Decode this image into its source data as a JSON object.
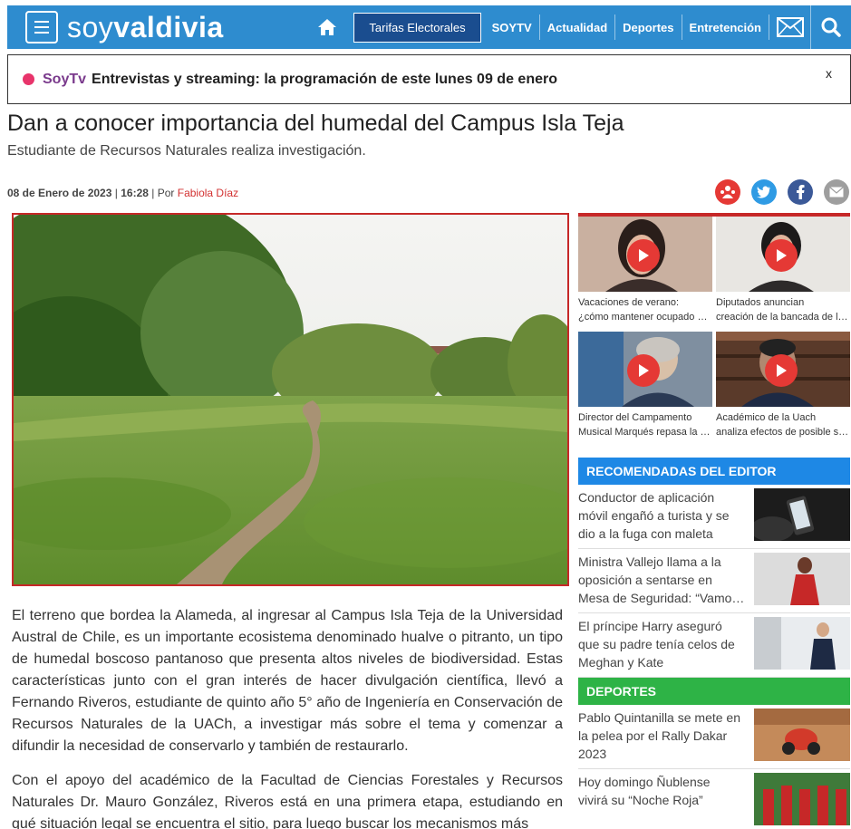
{
  "header": {
    "logo_light": "soy",
    "logo_bold": "valdivia",
    "tarifas": "Tarifas Electorales",
    "nav": [
      "SOYTV",
      "Actualidad",
      "Deportes",
      "Entretención"
    ]
  },
  "ticker": {
    "brand": "SoyTv",
    "text": "Entrevistas y streaming: la programación de este lunes 09 de enero",
    "close": "x"
  },
  "article": {
    "title": "Dan a conocer importancia del humedal del Campus Isla Teja",
    "subtitle": "Estudiante de Recursos Naturales realiza investigación.",
    "date": "08 de Enero de 2023",
    "sep": "|",
    "time": "16:28",
    "por": "| Por",
    "author": "Fabiola Díaz",
    "p1": "El terreno que bordea la Alameda, al ingresar al Campus Isla Teja de la Universidad Austral de Chile, es un importante ecosistema denominado hualve o pitranto, un tipo de humedal boscoso pantanoso que presenta altos niveles de biodiversidad. Estas características junto con el gran interés de hacer divulgación científica, llevó a Fernando Riveros, estudiante de quinto año 5° año de Ingeniería en Conservación de Recursos Naturales de la UACh, a investigar más sobre el tema y comenzar a difundir la necesidad de conservarlo y también de restaurarlo.",
    "p2": "Con el apoyo del académico de la Facultad de Ciencias Forestales y Recursos Naturales Dr. Mauro González, Riveros está en una primera etapa, estudiando en qué situación legal se encuentra el sitio, para luego buscar los mecanismos más"
  },
  "videos": [
    {
      "l1": "Vacaciones de verano:",
      "l2": "¿cómo mantener ocupado a los niños?"
    },
    {
      "l1": "Diputados anuncian",
      "l2": "creación de la bancada de la salud mental"
    },
    {
      "l1": "Director del Campamento",
      "l2": "Musical Marqués repasa la historia"
    },
    {
      "l1": "Académico de la Uach",
      "l2": "analiza efectos de posible sequía"
    }
  ],
  "recomendadas": {
    "title": "RECOMENDADAS DEL EDITOR",
    "items": [
      {
        "l1": "Conductor de aplicación",
        "l2": "móvil engañó a turista y se",
        "l3": "dio a la fuga con maleta"
      },
      {
        "l1": "Ministra Vallejo llama a la",
        "l2": "oposición a sentarse en",
        "l3": "Mesa de Seguridad: “Vamos a trabajar”"
      },
      {
        "l1": "El príncipe Harry aseguró",
        "l2": "que su padre tenía celos de",
        "l3": "Meghan y Kate"
      }
    ]
  },
  "deportes": {
    "title": "DEPORTES",
    "items": [
      {
        "l1": "Pablo Quintanilla se mete en",
        "l2": "la pelea por el Rally Dakar",
        "l3": "2023"
      },
      {
        "l1": "Hoy domingo Ñublense",
        "l2": "vivirá su “Noche Roja”",
        "l3": ""
      }
    ]
  },
  "colors": {
    "topbar": "#2e8ccf",
    "tarifas_bg": "#1a4d8f",
    "accent_red": "#c62828",
    "recomendadas": "#1e88e5",
    "deportes": "#2eb346",
    "twitter": "#2f9be4",
    "facebook": "#3b5998"
  },
  "icons": [
    "menu-icon",
    "home-icon",
    "mail-icon",
    "search-icon",
    "share-people-icon",
    "twitter-icon",
    "facebook-icon",
    "email-icon",
    "play-icon"
  ]
}
